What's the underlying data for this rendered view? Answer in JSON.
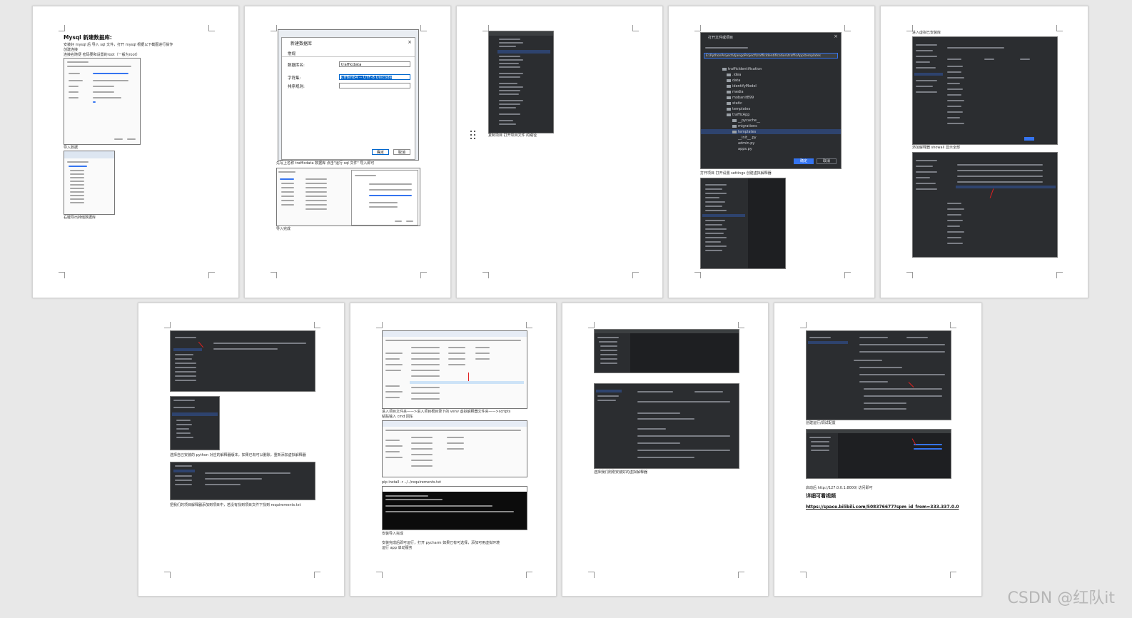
{
  "pages": [
    {
      "heading": "Mysql 新建数据库:",
      "captions": [
        "安装好 mysql 后 导入 sql 文件，打开 mysql 根据以下截图进行操作",
        "创建连接",
        "连接名随便 密码要和设置的root（一般为root）",
        "导入数据",
        "右键导出转储数据库"
      ]
    },
    {
      "dialog": {
        "title": "新建数据库",
        "tab": "常规",
        "db_label": "数据库名:",
        "db_value": "trafficdata",
        "charset_label": "字符集:",
        "charset_value": "utf8mb4 -- UTF-8 Unicode",
        "collation_label": "排序规则:",
        "ok": "确定",
        "cancel": "取消"
      },
      "captions": [
        "先写上名称 trafficdata 数据库 点击\"运行 sql 文件\" 导入即可",
        "导入完成"
      ]
    },
    {
      "captions": [
        "复制项目 打开项目文件 的路径"
      ]
    },
    {
      "dialog_title": "打开文件或项目",
      "path": "E:\\PythonProject\\djangoProject\\trafficIdentification\\trafficApp\\templates",
      "tree": [
        "trafficIdentification",
        ".idea",
        "data",
        "identifyModel",
        "media",
        "mobanit899",
        "static",
        "templates",
        "trafficApp",
        "__pycache__",
        "migrations",
        "templates",
        "__init__.py",
        "admin.py",
        "apps.py"
      ],
      "ok": "确定",
      "cancel": "取消",
      "captions": [
        "打开项目 打开设置 settings 创建虚拟解释器"
      ]
    },
    {
      "captions": [
        "进入虚拟已安装库",
        "添加解释器 showall 显示全部"
      ]
    },
    {
      "captions": [
        "选择自己安装的 python 对应的解释器版本，如果已有可以删除，重新添加虚拟解释器",
        "把我们的项目解释器添加到项目中，若没有找到项目文件下找到 requirements.txt"
      ]
    },
    {
      "captions": [
        "进入项目文件夹——>进入项目根目录下的 venv 虚拟解释器文件夹——>scripts",
        "粘贴输入 cmd 回车",
        "pip install -r ../../requirements.txt",
        "安装导入完成",
        "安装完成后即可运行，打开 pycharm 如果已有可选择，添加可用虚拟环境",
        "运行 app 启动服务"
      ]
    },
    {
      "captions": [
        "选择我们刚刚安装好的虚拟解释器"
      ]
    },
    {
      "captions": [
        "创建运行/调试配置",
        "启动后 http://127.0.0.1:8000/ 访问即可",
        "详细可看视频",
        "https://space.bilibili.com/508376677?spm_id_from=333.337.0.0"
      ]
    }
  ],
  "watermark": "CSDN @红队it"
}
